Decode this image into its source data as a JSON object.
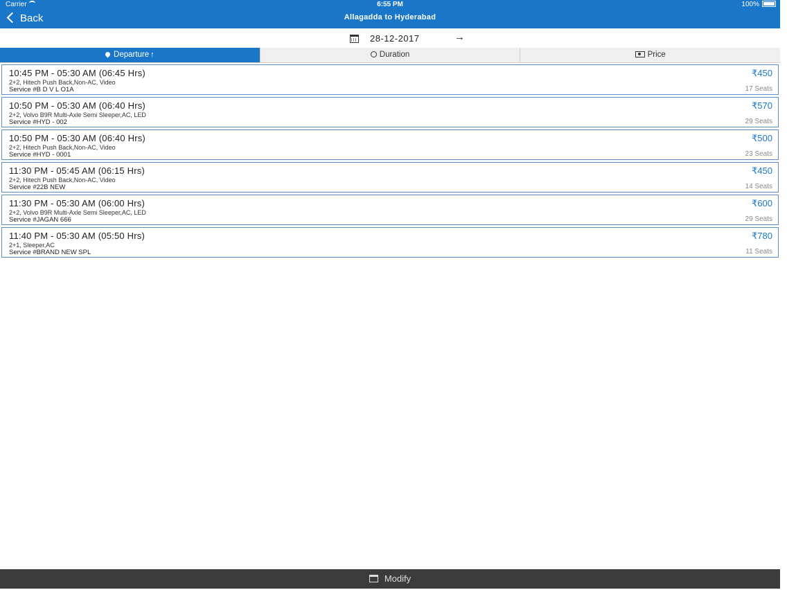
{
  "status_bar": {
    "carrier": "Carrier",
    "time": "6:55 PM",
    "battery": "100%"
  },
  "nav": {
    "back_label": "Back",
    "title": "Allagadda to Hyderabad"
  },
  "date_bar": {
    "date": "28-12-2017",
    "next_arrow": "→"
  },
  "sort_tabs": [
    {
      "label": "Departure",
      "active": true,
      "indicator": "↑"
    },
    {
      "label": "Duration",
      "active": false
    },
    {
      "label": "Price",
      "active": false
    }
  ],
  "buses": [
    {
      "times": "10:45 PM - 05:30 AM (06:45 Hrs)",
      "desc": "2+2, Hitech Push Back,Non-AC, Video",
      "service": "Service #B D V L O1A",
      "price": "₹450",
      "seats": "17 Seats"
    },
    {
      "times": "10:50 PM - 05:30 AM (06:40 Hrs)",
      "desc": "2+2, Volvo B9R Multi-Axle Semi Sleeper,AC, LED",
      "service": "Service #HYD - 002",
      "price": "₹570",
      "seats": "29 Seats"
    },
    {
      "times": "10:50 PM - 05:30 AM (06:40 Hrs)",
      "desc": "2+2, Hitech Push Back,Non-AC, Video",
      "service": "Service #HYD - 0001",
      "price": "₹500",
      "seats": "23 Seats"
    },
    {
      "times": "11:30 PM - 05:45 AM (06:15 Hrs)",
      "desc": "2+2, Hitech Push Back,Non-AC, Video",
      "service": "Service #22B NEW",
      "price": "₹450",
      "seats": "14 Seats"
    },
    {
      "times": "11:30 PM - 05:30 AM (06:00 Hrs)",
      "desc": "2+2, Volvo B9R Multi-Axle Semi Sleeper,AC, LED",
      "service": "Service #JAGAN 666",
      "price": "₹600",
      "seats": "29 Seats"
    },
    {
      "times": "11:40 PM - 05:30 AM (05:50 Hrs)",
      "desc": "2+1, Sleeper,AC",
      "service": "Service #BRAND NEW SPL",
      "price": "₹780",
      "seats": "11 Seats"
    }
  ],
  "footer": {
    "modify_label": "Modify"
  },
  "colors": {
    "primary": "#1976c9",
    "footer_bg": "#3b3b3b",
    "seats_text": "#888888"
  }
}
